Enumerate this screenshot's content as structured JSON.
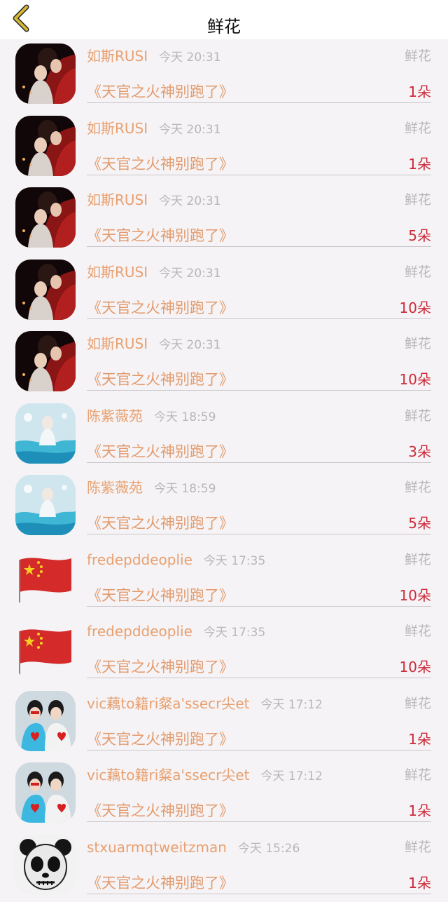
{
  "header": {
    "title": "鲜花"
  },
  "colors": {
    "accent_orange": "#e8a070",
    "count_red": "#cc2b3b",
    "muted_gray": "#b9b6b9",
    "back_yellow": "#d4b836"
  },
  "rows": [
    {
      "name": "如斯RUSI",
      "time": "今天 20:31",
      "type": "鲜花",
      "book": "《天官之火神别跑了》",
      "count": "1朵",
      "avatar": "anime-red-couple-avatar"
    },
    {
      "name": "如斯RUSI",
      "time": "今天 20:31",
      "type": "鲜花",
      "book": "《天官之火神别跑了》",
      "count": "1朵",
      "avatar": "anime-red-couple-avatar"
    },
    {
      "name": "如斯RUSI",
      "time": "今天 20:31",
      "type": "鲜花",
      "book": "《天官之火神别跑了》",
      "count": "5朵",
      "avatar": "anime-red-couple-avatar"
    },
    {
      "name": "如斯RUSI",
      "time": "今天 20:31",
      "type": "鲜花",
      "book": "《天官之火神别跑了》",
      "count": "10朵",
      "avatar": "anime-red-couple-avatar"
    },
    {
      "name": "如斯RUSI",
      "time": "今天 20:31",
      "type": "鲜花",
      "book": "《天官之火神别跑了》",
      "count": "10朵",
      "avatar": "anime-red-couple-avatar"
    },
    {
      "name": "陈紫薇苑",
      "time": "今天 18:59",
      "type": "鲜花",
      "book": "《天官之火神别跑了》",
      "count": "3朵",
      "avatar": "fantasy-blue-water-avatar"
    },
    {
      "name": "陈紫薇苑",
      "time": "今天 18:59",
      "type": "鲜花",
      "book": "《天官之火神别跑了》",
      "count": "5朵",
      "avatar": "fantasy-blue-water-avatar"
    },
    {
      "name": "fredepddeoplie",
      "time": "今天 17:35",
      "type": "鲜花",
      "book": "《天官之火神别跑了》",
      "count": "10朵",
      "avatar": "china-flag-avatar"
    },
    {
      "name": "fredepddeoplie",
      "time": "今天 17:35",
      "type": "鲜花",
      "book": "《天官之火神别跑了》",
      "count": "10朵",
      "avatar": "china-flag-avatar"
    },
    {
      "name": "vic藕to籍ri粲a'ssecr尖et",
      "time": "今天 17:12",
      "type": "鲜花",
      "book": "《天官之火神别跑了》",
      "count": "1朵",
      "avatar": "girls-heart-shirt-avatar"
    },
    {
      "name": "vic藕to籍ri粲a'ssecr尖et",
      "time": "今天 17:12",
      "type": "鲜花",
      "book": "《天官之火神别跑了》",
      "count": "1朵",
      "avatar": "girls-heart-shirt-avatar"
    },
    {
      "name": "stxuarmqtweitzman",
      "time": "今天 15:26",
      "type": "鲜花",
      "book": "《天官之火神别跑了》",
      "count": "1朵",
      "avatar": "panda-face-avatar"
    }
  ]
}
